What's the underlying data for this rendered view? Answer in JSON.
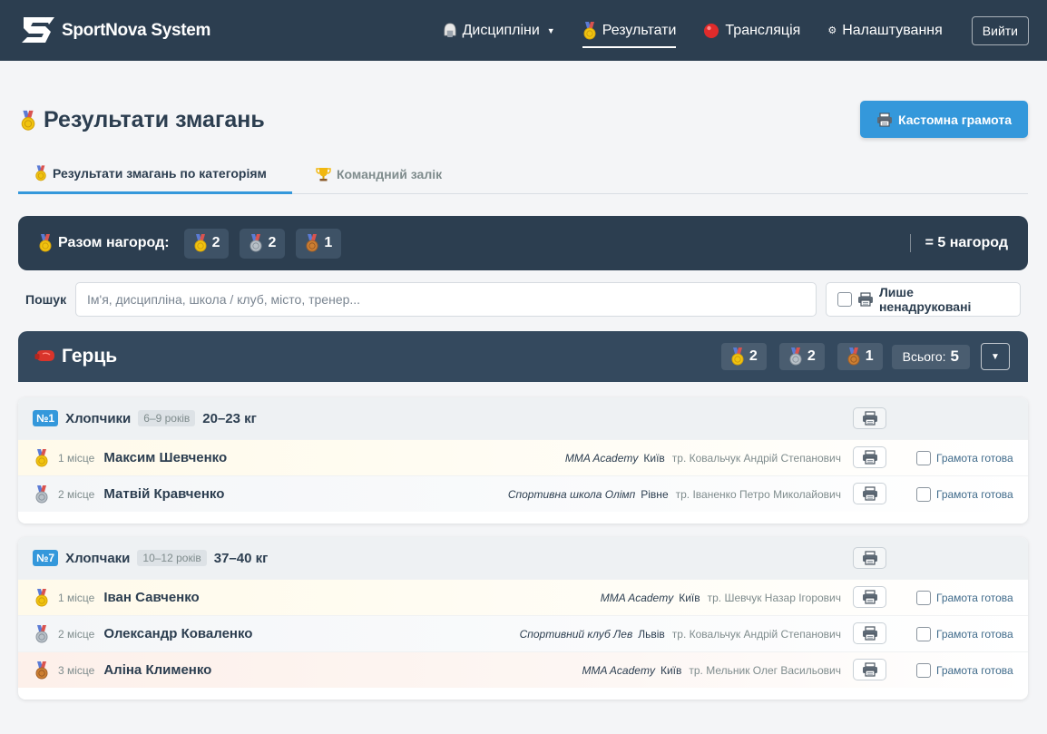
{
  "app": {
    "title": "SportNova System"
  },
  "nav": {
    "disciplines": "Дисципліни",
    "results": "Результати",
    "broadcast": "Трансляція",
    "settings": "Налаштування",
    "logout": "Вийти"
  },
  "page": {
    "title": "Результати змагань",
    "custom_diploma": "Кастомна грамота"
  },
  "tabs": [
    {
      "label": "Результати змагань по категоріям",
      "active": true
    },
    {
      "label": "Командний залік",
      "active": false
    }
  ],
  "summary": {
    "label": "Разом нагород:",
    "gold": "2",
    "silver": "2",
    "bronze": "1",
    "total": "= 5 нагород"
  },
  "search": {
    "label": "Пошук",
    "placeholder": "Ім'я, дисципліна, школа / клуб, місто, тренер...",
    "value": "",
    "unprinted_only": "Лише ненадруковані",
    "unprinted_checked": false
  },
  "discipline": {
    "name": "Герць",
    "gold": "2",
    "silver": "2",
    "bronze": "1",
    "total_label": "Всього:",
    "total": "5"
  },
  "categories": [
    {
      "num": "№1",
      "name": "Хлопчики",
      "age": "6–9 років",
      "weight": "20–23 кг",
      "rows": [
        {
          "medal": "gold",
          "place": "1 місце",
          "athlete": "Максим Шевченко",
          "school": "MMA Academy",
          "city": "Київ",
          "coach": "тр. Ковальчук Андрій Степанович",
          "ready_label": "Грамота готова",
          "ready": false
        },
        {
          "medal": "silver",
          "place": "2 місце",
          "athlete": "Матвій Кравченко",
          "school": "Спортивна школа Олімп",
          "city": "Рівне",
          "coach": "тр. Іваненко Петро Миколайович",
          "ready_label": "Грамота готова",
          "ready": false
        }
      ]
    },
    {
      "num": "№7",
      "name": "Хлопчаки",
      "age": "10–12 років",
      "weight": "37–40 кг",
      "rows": [
        {
          "medal": "gold",
          "place": "1 місце",
          "athlete": "Іван Савченко",
          "school": "MMA Academy",
          "city": "Київ",
          "coach": "тр. Шевчук Назар Ігорович",
          "ready_label": "Грамота готова",
          "ready": false
        },
        {
          "medal": "silver",
          "place": "2 місце",
          "athlete": "Олександр Коваленко",
          "school": "Спортивний клуб Лев",
          "city": "Львів",
          "coach": "тр. Ковальчук Андрій Степанович",
          "ready_label": "Грамота готова",
          "ready": false
        },
        {
          "medal": "bronze",
          "place": "3 місце",
          "athlete": "Аліна Клименко",
          "school": "MMA Academy",
          "city": "Київ",
          "coach": "тр. Мельник Олег Васильович",
          "ready_label": "Грамота готова",
          "ready": false
        }
      ]
    }
  ],
  "colors": {
    "navbar": "#2c3e50",
    "accent": "#3498db",
    "gold": "#f1c40f",
    "silver": "#a9b2ba",
    "bronze": "#cd7f32"
  }
}
